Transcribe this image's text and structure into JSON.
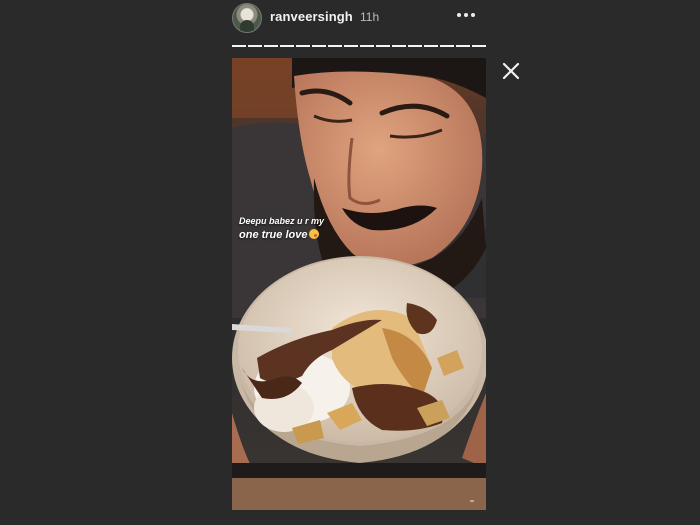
{
  "story": {
    "username": "ranveersingh",
    "timestamp": "11h",
    "avatar_icon": "user-avatar",
    "more_icon": "more-options-icon",
    "close_icon": "close-icon",
    "progress_segments": 16,
    "current_segment": 16,
    "caption_line1": "Deepu babez u r my",
    "caption_line2": "one true love",
    "caption_emoji": "kiss-face-emoji"
  },
  "colors": {
    "background": "#2a2a2a",
    "text_primary": "#f2f2f2",
    "text_secondary": "#bdbdbd",
    "footer_strip": "#8a644b"
  }
}
